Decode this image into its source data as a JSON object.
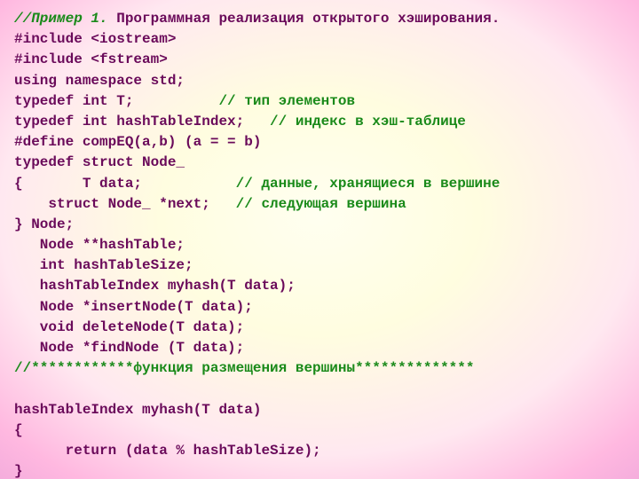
{
  "lines": [
    {
      "parts": [
        {
          "cls": "green",
          "text": "//Пример 1."
        },
        {
          "cls": "line",
          "text": " Программная реализация открытого хэширования."
        }
      ]
    },
    {
      "parts": [
        {
          "cls": "line",
          "text": "#include <iostream>"
        }
      ]
    },
    {
      "parts": [
        {
          "cls": "line",
          "text": "#include <fstream>"
        }
      ]
    },
    {
      "parts": [
        {
          "cls": "line",
          "text": "using namespace std;"
        }
      ]
    },
    {
      "parts": [
        {
          "cls": "line",
          "text": "typedef int T;          "
        },
        {
          "cls": "green-upright",
          "text": "// тип элементов"
        }
      ]
    },
    {
      "parts": [
        {
          "cls": "line",
          "text": "typedef int hashTableIndex;   "
        },
        {
          "cls": "green-upright",
          "text": "// индекс в хэш-таблице"
        }
      ]
    },
    {
      "parts": [
        {
          "cls": "line",
          "text": "#define compEQ(a,b) (a = = b)"
        }
      ]
    },
    {
      "parts": [
        {
          "cls": "line",
          "text": "typedef struct Node_"
        }
      ]
    },
    {
      "parts": [
        {
          "cls": "line",
          "text": "{       T data;           "
        },
        {
          "cls": "green-upright",
          "text": "// данные, хранящиеся в вершине"
        }
      ]
    },
    {
      "parts": [
        {
          "cls": "line",
          "text": "    struct Node_ *next;   "
        },
        {
          "cls": "green-upright",
          "text": "// следующая вершина"
        }
      ]
    },
    {
      "parts": [
        {
          "cls": "line",
          "text": "} Node;"
        }
      ]
    },
    {
      "parts": [
        {
          "cls": "line",
          "text": "   Node **hashTable;"
        }
      ]
    },
    {
      "parts": [
        {
          "cls": "line",
          "text": "   int hashTableSize;"
        }
      ]
    },
    {
      "parts": [
        {
          "cls": "line",
          "text": "   hashTableIndex myhash(T data);"
        }
      ]
    },
    {
      "parts": [
        {
          "cls": "line",
          "text": "   Node *insertNode(T data);"
        }
      ]
    },
    {
      "parts": [
        {
          "cls": "line",
          "text": "   void deleteNode(T data);"
        }
      ]
    },
    {
      "parts": [
        {
          "cls": "line",
          "text": "   Node *findNode (T data);"
        }
      ]
    },
    {
      "parts": [
        {
          "cls": "green-upright",
          "text": "//************функция размещения вершины**************"
        }
      ]
    },
    {
      "parts": [
        {
          "cls": "line",
          "text": " "
        }
      ]
    },
    {
      "parts": [
        {
          "cls": "line",
          "text": "hashTableIndex myhash(T data)"
        }
      ]
    },
    {
      "parts": [
        {
          "cls": "line",
          "text": "{"
        }
      ]
    },
    {
      "parts": [
        {
          "cls": "line",
          "text": "      return (data % hashTableSize);"
        }
      ]
    },
    {
      "parts": [
        {
          "cls": "line",
          "text": "}"
        }
      ]
    }
  ]
}
